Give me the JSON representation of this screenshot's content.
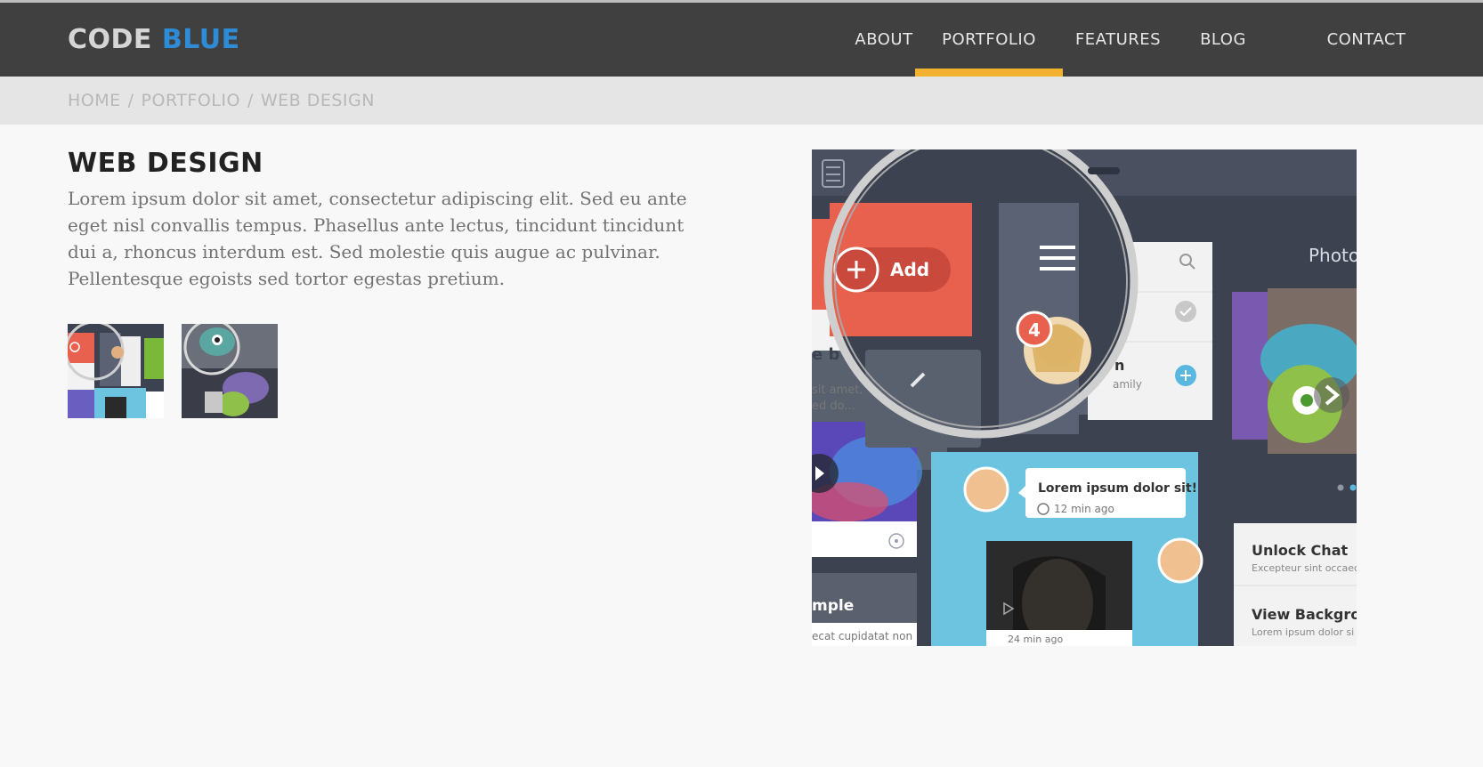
{
  "brand": {
    "part1": "CODE",
    "part2": "BLUE"
  },
  "nav": {
    "items": [
      {
        "label": "ABOUT",
        "active": false
      },
      {
        "label": "PORTFOLIO",
        "active": true
      },
      {
        "label": "FEATURES",
        "active": false
      },
      {
        "label": "BLOG",
        "active": false
      },
      {
        "label": "CONTACT",
        "active": false
      }
    ]
  },
  "breadcrumb": {
    "items": [
      "HOME",
      "PORTFOLIO",
      "WEB DESIGN"
    ],
    "separator": "/"
  },
  "page": {
    "title": "WEB DESIGN",
    "description": "Lorem ipsum dolor sit amet, consectetur adipiscing elit. Sed eu ante eget nisl convallis tempus. Phasellus ante lectus, tincidunt tincidunt dui a, rhoncus interdum est. Sed molestie quis augue ac pulvinar. Pellentesque egoists sed tortor egestas pretium."
  },
  "gallery": {
    "thumbnails": [
      {
        "name": "ui-kit-thumbnail"
      },
      {
        "name": "monster-thumbnail"
      }
    ]
  },
  "hero": {
    "add_label": "Add",
    "badge_count": "4",
    "photo_label": "Photo",
    "card_fragment_1": "e b",
    "card_text_1a": "sit amet,",
    "card_text_1b": "ed do...",
    "name_fragment": "n",
    "name_sub": "amily",
    "chat_text": "Lorem ipsum dolor sit!",
    "chat_time": "12 min ago",
    "chat_time_2": "24 min ago",
    "unlock_title": "Unlock Chat",
    "unlock_sub": "Excepteur sint occaec",
    "view_title": "View Backgrour",
    "view_sub": "Lorem ipsum dolor si",
    "sample_label": "mple",
    "sample_sub": "ecat cupidatat non"
  },
  "colors": {
    "navbar": "#404040",
    "brand_accent": "#2e8bd6",
    "active_underline": "#f2b230",
    "breadcrumb_bar": "#e5e5e5",
    "coral": "#e8604e",
    "sky": "#6cc4e0",
    "slate": "#3c4250"
  }
}
